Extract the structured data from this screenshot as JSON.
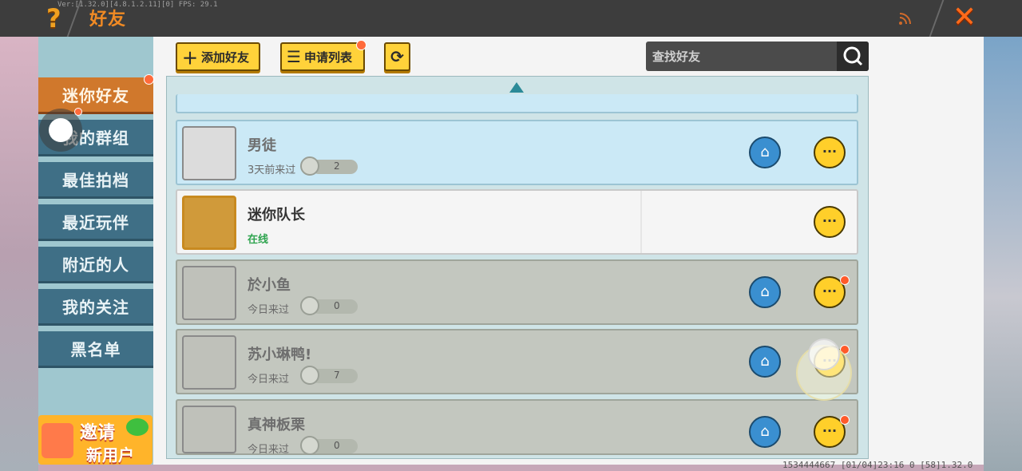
{
  "header": {
    "title": "好友",
    "debug_text": "Ver:[1.32.0][4.8.1.2.11][0] FPS: 29.1"
  },
  "sidebar": {
    "items": [
      {
        "label": "迷你好友",
        "active": true
      },
      {
        "label": "我的群组"
      },
      {
        "label": "最佳拍档"
      },
      {
        "label": "最近玩伴"
      },
      {
        "label": "附近的人"
      },
      {
        "label": "我的关注"
      },
      {
        "label": "黑名单"
      }
    ],
    "invite": {
      "line1": "邀请",
      "line2": "新用户"
    }
  },
  "toolbar": {
    "add_friend_label": "添加好友",
    "request_list_label": "申请列表",
    "search_placeholder": "查找好友"
  },
  "friends": [
    {
      "name": "男徒",
      "status": "3天前来过",
      "trophy_count": "2",
      "style": "blue"
    },
    {
      "name": "迷你队长",
      "status": "在线",
      "style": "white"
    },
    {
      "name": "於小鱼",
      "status": "今日来过",
      "trophy_count": "0",
      "style": "gray"
    },
    {
      "name": "苏小琳鸭!",
      "status": "今日来过",
      "trophy_count": "7",
      "style": "gray"
    },
    {
      "name": "真神板栗",
      "status": "今日来过",
      "trophy_count": "0",
      "style": "gray"
    }
  ],
  "footer": {
    "text": "1534444667  [01/04]23:16 0  [58]1.32.0"
  },
  "colors": {
    "accent_orange": "#d0782c",
    "sidebar_blue": "#3f6f86",
    "button_yellow": "#ffd23a",
    "online_green": "#2fa44f"
  },
  "icons": {
    "help": "question-mark-icon",
    "close": "close-x-icon",
    "rss": "signal-icon",
    "add": "plus-icon",
    "requests": "list-icon",
    "refresh": "refresh-icon",
    "search": "magnifier-icon",
    "home": "home-icon",
    "chat": "chat-bubble-icon",
    "scroll_up": "triangle-up-icon"
  }
}
